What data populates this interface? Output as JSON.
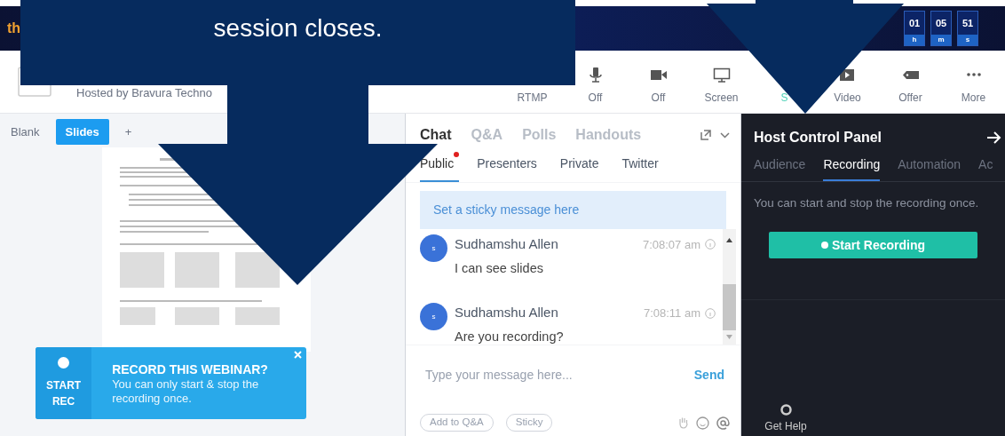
{
  "callout": {
    "text": "session closes."
  },
  "header": {
    "brand": "th",
    "timer": [
      {
        "value": "01",
        "unit": "h"
      },
      {
        "value": "05",
        "unit": "m"
      },
      {
        "value": "51",
        "unit": "s"
      }
    ]
  },
  "toolbar": {
    "host": "Hosted by Bravura Techno",
    "items": [
      {
        "label": "RTMP",
        "kind": "rtmp",
        "selected": false
      },
      {
        "label": "Off",
        "kind": "mic",
        "selected": false
      },
      {
        "label": "Off",
        "kind": "camera",
        "selected": false
      },
      {
        "label": "Screen",
        "kind": "screen",
        "selected": false
      },
      {
        "label": "S",
        "kind": "slides",
        "selected": true
      },
      {
        "label": "Video",
        "kind": "video",
        "selected": false
      },
      {
        "label": "Offer",
        "kind": "offer",
        "selected": false
      },
      {
        "label": "More",
        "kind": "more",
        "selected": false
      }
    ]
  },
  "slides_panel": {
    "tabs": [
      {
        "label": "Blank",
        "selected": false
      },
      {
        "label": "Slides",
        "selected": true
      },
      {
        "label": "+",
        "selected": false
      }
    ],
    "record_prompt": {
      "button": "START REC",
      "title": "RECORD THIS WEBINAR?",
      "text": "You can only start & stop the recording once."
    }
  },
  "chat": {
    "tabs": [
      {
        "label": "Chat",
        "selected": true
      },
      {
        "label": "Q&A",
        "selected": false
      },
      {
        "label": "Polls",
        "selected": false
      },
      {
        "label": "Handouts",
        "selected": false
      }
    ],
    "subtabs": [
      {
        "label": "Public",
        "selected": true,
        "unread": true
      },
      {
        "label": "Presenters",
        "selected": false,
        "unread": false
      },
      {
        "label": "Private",
        "selected": false,
        "unread": false
      },
      {
        "label": "Twitter",
        "selected": false,
        "unread": false
      }
    ],
    "sticky": "Set a sticky message here",
    "messages": [
      {
        "initial": "s",
        "name": "Sudhamshu Allen",
        "time": "7:08:07 am",
        "text": "I can see slides"
      },
      {
        "initial": "s",
        "name": "Sudhamshu Allen",
        "time": "7:08:11 am",
        "text": "Are you recording?"
      }
    ],
    "input": {
      "placeholder": "Type your message here..."
    },
    "send": "Send",
    "actions": [
      "Add to Q&A",
      "Sticky"
    ]
  },
  "host_panel": {
    "title": "Host Control Panel",
    "tabs": [
      {
        "label": "Audience",
        "selected": false
      },
      {
        "label": "Recording",
        "selected": true
      },
      {
        "label": "Automation",
        "selected": false
      },
      {
        "label": "Ac",
        "selected": false
      }
    ],
    "note": "You can start and stop the recording once.",
    "button": "Start Recording",
    "help": "Get Help"
  }
}
